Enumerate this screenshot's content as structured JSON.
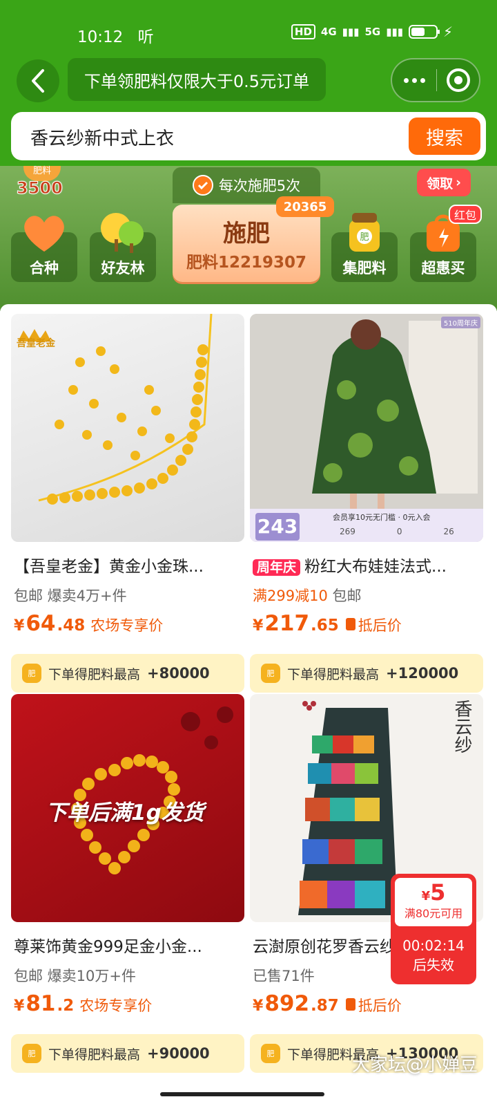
{
  "status_bar": {
    "time": "10:12",
    "extra": "听",
    "hd": "HD",
    "net1": "4G",
    "net2": "5G",
    "battery_level": 0.55
  },
  "nav": {
    "promo": "下单领肥料仅限大于0.5元订单"
  },
  "search": {
    "query": "香云纱新中式上衣",
    "button": "搜索"
  },
  "farm": {
    "stock_label": "肥料",
    "stock_value": "3500",
    "each_time": "每次施肥5次",
    "claim": "领取",
    "fertilize": "施肥",
    "fertilize_sub": "肥料12219307",
    "badge": "20365",
    "tiles": [
      {
        "label": "合种",
        "icon": "heart-icon"
      },
      {
        "label": "好友林",
        "icon": "trees-icon"
      },
      {
        "label": "集肥料",
        "icon": "fertilizer-bag-icon"
      },
      {
        "label": "超惠买",
        "icon": "shopping-bag-icon"
      }
    ],
    "hongbao": "红包"
  },
  "products": [
    {
      "img_brand": "吾皇老金",
      "title": "【吾皇老金】黄金小金珠...",
      "sub": "包邮 爆卖4万+件",
      "price_int": "64",
      "price_dec": ".48",
      "price_tag": "农场专享价",
      "reward_label": "下单得肥料最高",
      "reward_amount": "+80000"
    },
    {
      "img_corner": "510周年庆",
      "img_price": "243",
      "img_banner": "会员享10元无门槛 · 0元入会",
      "img_stats": [
        "269",
        "0",
        "26"
      ],
      "badge": "周年庆",
      "title": "粉红大布娃娃法式...",
      "sub_hl": "满299减10",
      "sub": "包邮",
      "price_int": "217",
      "price_dec": ".65",
      "price_tag": "抵后价",
      "reward_label": "下单得肥料最高",
      "reward_amount": "+120000"
    },
    {
      "img_text": "下单后满1g发货",
      "title": "尊莱饰黄金999足金小金...",
      "sub": "包邮 爆卖10万+件",
      "price_int": "81",
      "price_dec": ".2",
      "price_tag": "农场专享价",
      "reward_label": "下单得肥料最高",
      "reward_amount": "+90000"
    },
    {
      "img_callig": "香云纱",
      "title": "云澍原创花罗香云纱...",
      "sub": "已售71件",
      "price_int": "892",
      "price_dec": ".87",
      "price_tag": "抵后价",
      "reward_label": "下单得肥料最高",
      "reward_amount": "+130000"
    }
  ],
  "currency": "¥",
  "coupon": {
    "currency": "¥",
    "value": "5",
    "condition": "满80元可用",
    "timer": "00:02:14",
    "expire": "后失效"
  },
  "watermark": "大家坛@小婵豆"
}
